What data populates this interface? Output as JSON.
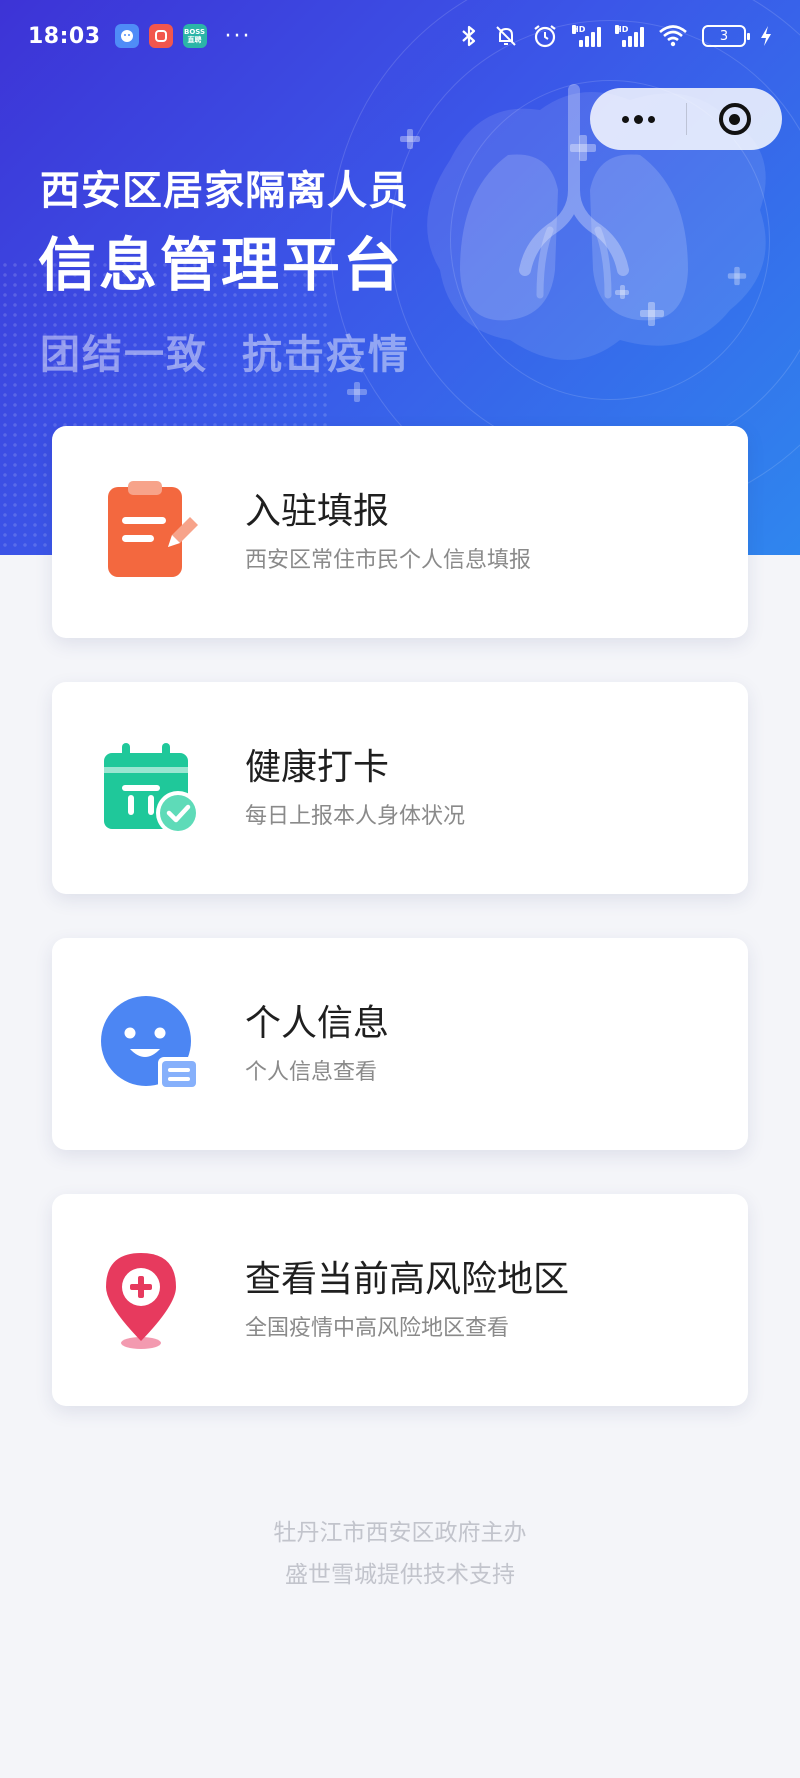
{
  "status_bar": {
    "time": "18:03",
    "app_icons": [
      "chat-app-icon",
      "red-app-icon",
      "boss-app-icon"
    ],
    "boss_label": "BOSS\n直聘",
    "more": "···",
    "signal_label_1": "HD",
    "signal_label_2": "HD",
    "battery_level": "3",
    "icons": [
      "bluetooth-icon",
      "mute-bell-icon",
      "alarm-icon",
      "signal-icon",
      "wifi-icon",
      "battery-icon",
      "charging-icon"
    ]
  },
  "capsule": {
    "more_icon": "more-dots-icon",
    "close_icon": "target-close-icon"
  },
  "header": {
    "title_line1": "西安区居家隔离人员",
    "title_line2": "信息管理平台",
    "slogan_1": "团结一致",
    "slogan_2": "抗击疫情"
  },
  "cards": [
    {
      "title": "入驻填报",
      "subtitle": "西安区常住市民个人信息填报",
      "icon": "clipboard-edit-icon",
      "color": "#f3683f"
    },
    {
      "title": "健康打卡",
      "subtitle": "每日上报本人身体状况",
      "icon": "calendar-check-icon",
      "color": "#1fc89a"
    },
    {
      "title": "个人信息",
      "subtitle": "个人信息查看",
      "icon": "smiley-profile-icon",
      "color": "#4c86f3"
    },
    {
      "title": "查看当前高风险地区",
      "subtitle": "全国疫情中高风险地区查看",
      "icon": "location-pin-cross-icon",
      "color": "#e73a5e"
    }
  ],
  "footer": {
    "line1": "牡丹江市西安区政府主办",
    "line2": "盛世雪城提供技术支持"
  },
  "colors": {
    "header_gradient_start": "#3d33d6",
    "header_gradient_end": "#2f86ee",
    "page_background": "#f4f5f9"
  }
}
